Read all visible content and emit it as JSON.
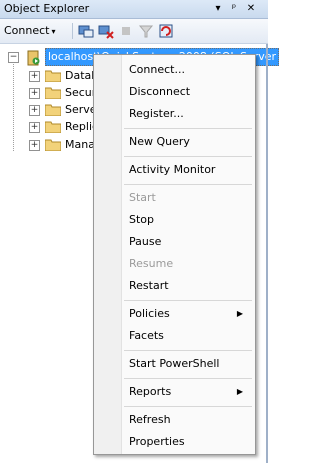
{
  "window": {
    "title": "Object Explorer",
    "pin_icon": "pin-icon",
    "dropdown_icon": "dropdown-arrow-icon",
    "close_icon": "close-icon"
  },
  "toolbar": {
    "connect_label": "Connect",
    "connect_arrow": "▾"
  },
  "tree": {
    "server_label": "localhost\\QuickSystems2008 (SQL Server",
    "items": [
      {
        "label": "Datab"
      },
      {
        "label": "Secur"
      },
      {
        "label": "Serve"
      },
      {
        "label": "Replic"
      },
      {
        "label": "Mana"
      }
    ]
  },
  "context_menu": {
    "items": [
      {
        "label": "Connect..."
      },
      {
        "label": "Disconnect"
      },
      {
        "label": "Register..."
      },
      {
        "label": "New Query"
      },
      {
        "label": "Activity Monitor"
      },
      {
        "label": "Start"
      },
      {
        "label": "Stop"
      },
      {
        "label": "Pause"
      },
      {
        "label": "Resume"
      },
      {
        "label": "Restart"
      },
      {
        "label": "Policies"
      },
      {
        "label": "Facets"
      },
      {
        "label": "Start PowerShell"
      },
      {
        "label": "Reports"
      },
      {
        "label": "Refresh"
      },
      {
        "label": "Properties"
      }
    ],
    "submenu_arrow": "▶"
  }
}
